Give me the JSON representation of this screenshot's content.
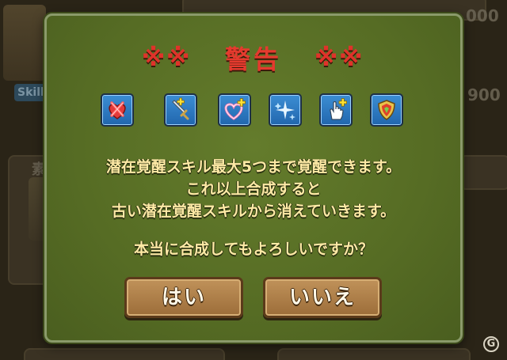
{
  "dialog": {
    "title": "警告",
    "title_marks": "※※",
    "icons": [
      {
        "name": "heart-cross-icon"
      },
      {
        "name": "sword-plus-icon"
      },
      {
        "name": "heart-plus-icon"
      },
      {
        "name": "sparkle-icon"
      },
      {
        "name": "hand-plus-icon"
      },
      {
        "name": "shield-icon"
      }
    ],
    "message_lines": [
      "潜在覚醒スキル最大5つまで覚醒できます。",
      "これ以上合成すると",
      "古い潜在覚醒スキルから消えていきます。"
    ],
    "question": "本当に合成してもよろしいですか？",
    "yes_label": "はい",
    "no_label": "いいえ"
  },
  "background": {
    "skill_label": "Skill",
    "value_top_right": "000",
    "value_mid_right": "900",
    "value_left": "素"
  },
  "watermark": "G",
  "colors": {
    "dialog_bg": "#5e7528",
    "title_red": "#e53a2e",
    "message_text": "#ffeaa6",
    "button_brown": "#b0814b",
    "icon_blue": "#2f7fc6"
  }
}
